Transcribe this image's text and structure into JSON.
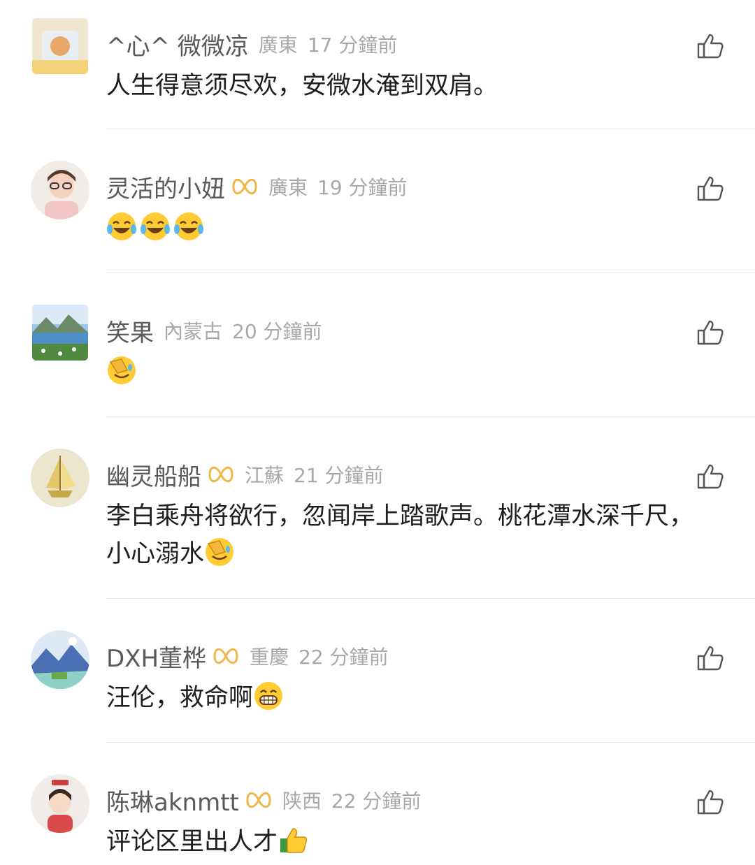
{
  "comments": [
    {
      "username": "^心^ 微微凉",
      "region": "廣東",
      "time": "17 分鐘前",
      "text": "人生得意须尽欢，安微水淹到双肩。",
      "emojis": [],
      "badge": false
    },
    {
      "username": "灵活的小妞",
      "region": "廣東",
      "time": "19 分鐘前",
      "text": "",
      "emojis": [
        "laugh-tears-emoji",
        "laugh-tears-emoji",
        "laugh-tears-emoji"
      ],
      "badge": true
    },
    {
      "username": "笑果",
      "region": "內蒙古",
      "time": "20 分鐘前",
      "text": "",
      "emojis": [
        "facepalm-emoji"
      ],
      "badge": false
    },
    {
      "username": "幽灵船船",
      "region": "江蘇",
      "time": "21 分鐘前",
      "text": "李白乘舟将欲行，忽闻岸上踏歌声。桃花潭水深千尺，小心溺水",
      "emojis": [
        "facepalm-emoji"
      ],
      "badge": true
    },
    {
      "username": "DXH董桦",
      "region": "重慶",
      "time": "22 分鐘前",
      "text": "汪伦，救命啊",
      "emojis": [
        "grin-emoji"
      ],
      "badge": true
    },
    {
      "username": "陈琳aknmtt",
      "region": "陕西",
      "time": "22 分鐘前",
      "text": "评论区里出人才",
      "emojis": [
        "thumbs-up-emoji"
      ],
      "badge": true
    }
  ],
  "icons": {
    "like": "thumbs-up-outline-icon",
    "badge": "membership-badge-icon"
  },
  "colors": {
    "username": "#5a5a5a",
    "meta": "#a8a8a8",
    "text": "#1e1e1e",
    "badge": "#f0b64a",
    "divider": "#e6e6e6"
  }
}
